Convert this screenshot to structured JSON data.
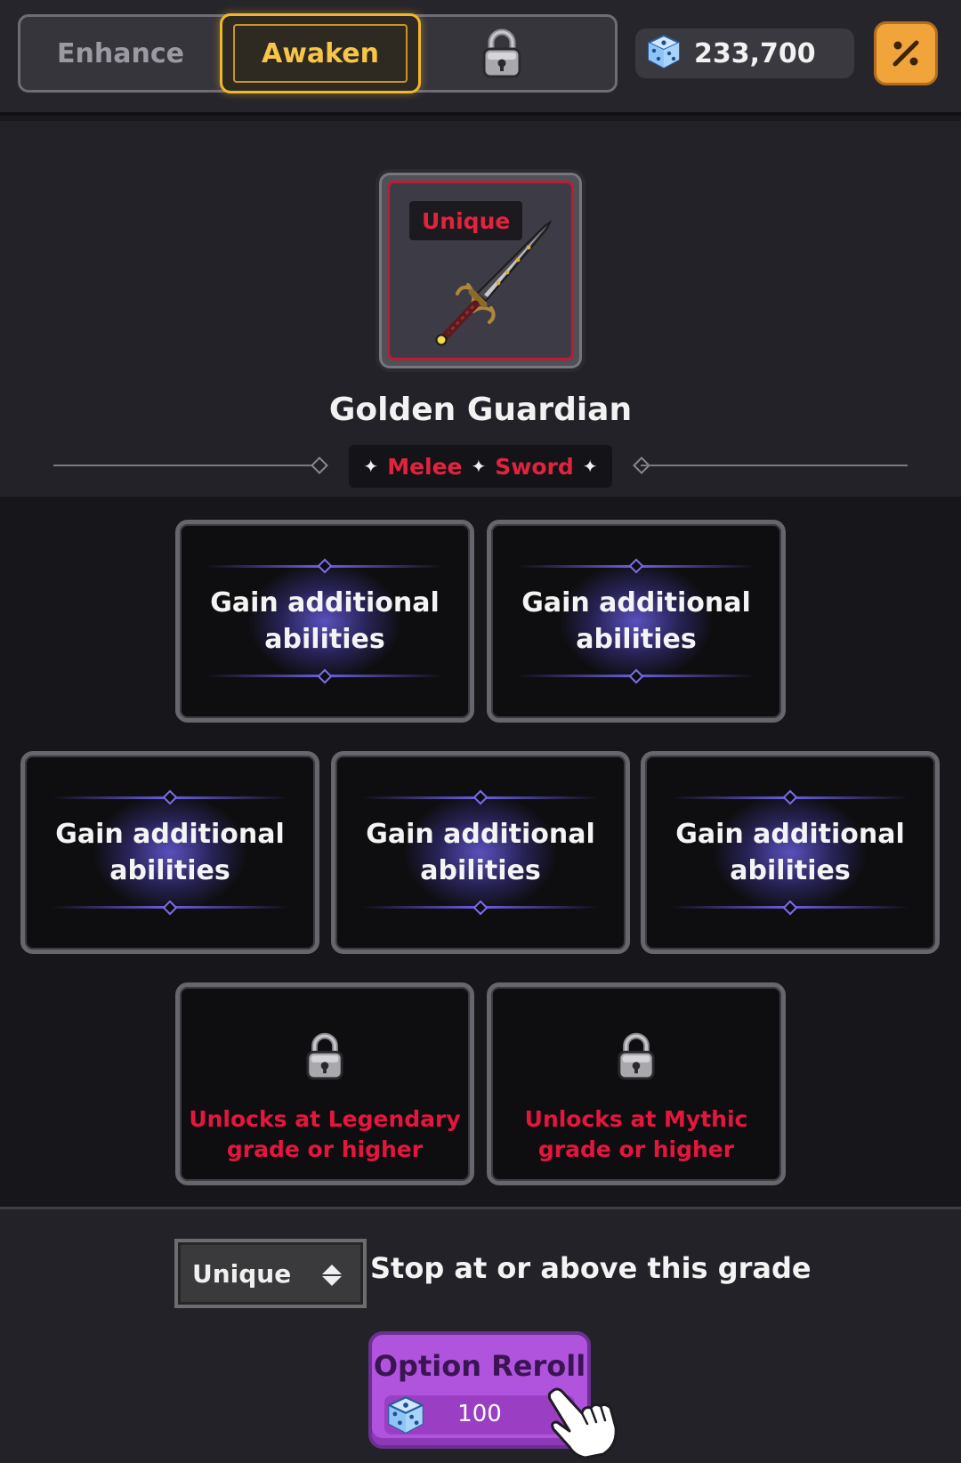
{
  "tabs": {
    "enhance_label": "Enhance",
    "awaken_label": "Awaken",
    "active": "Awaken",
    "third_tab_icon": "lock-icon"
  },
  "currency": {
    "icon": "dice-icon",
    "amount": "233,700"
  },
  "percent_button_icon": "percent-icon",
  "item": {
    "grade": "Unique",
    "grade_color": "#e0243f",
    "icon": "sword-icon",
    "name": "Golden Guardian",
    "tags": [
      "Melee",
      "Sword"
    ]
  },
  "options": [
    {
      "text": "Gain additional\nabilities",
      "locked": false
    },
    {
      "text": "Gain additional\nabilities",
      "locked": false
    },
    {
      "text": "Gain additional\nabilities",
      "locked": false
    },
    {
      "text": "Gain additional\nabilities",
      "locked": false
    },
    {
      "text": "Gain additional\nabilities",
      "locked": false
    },
    {
      "text": "Unlocks at Legendary\ngrade or higher",
      "locked": true
    },
    {
      "text": "Unlocks at Mythic\ngrade or higher",
      "locked": true
    }
  ],
  "stop_grade": {
    "selected": "Unique",
    "label": "Stop at or above this grade"
  },
  "reroll": {
    "label": "Option Reroll",
    "cost_icon": "dice-icon",
    "cost": "100"
  },
  "colors": {
    "accent_gold": "#f1b62e",
    "option_glow": "#6c5ee6",
    "locked_text": "#e5163e",
    "reroll_button": "#b054dd"
  }
}
